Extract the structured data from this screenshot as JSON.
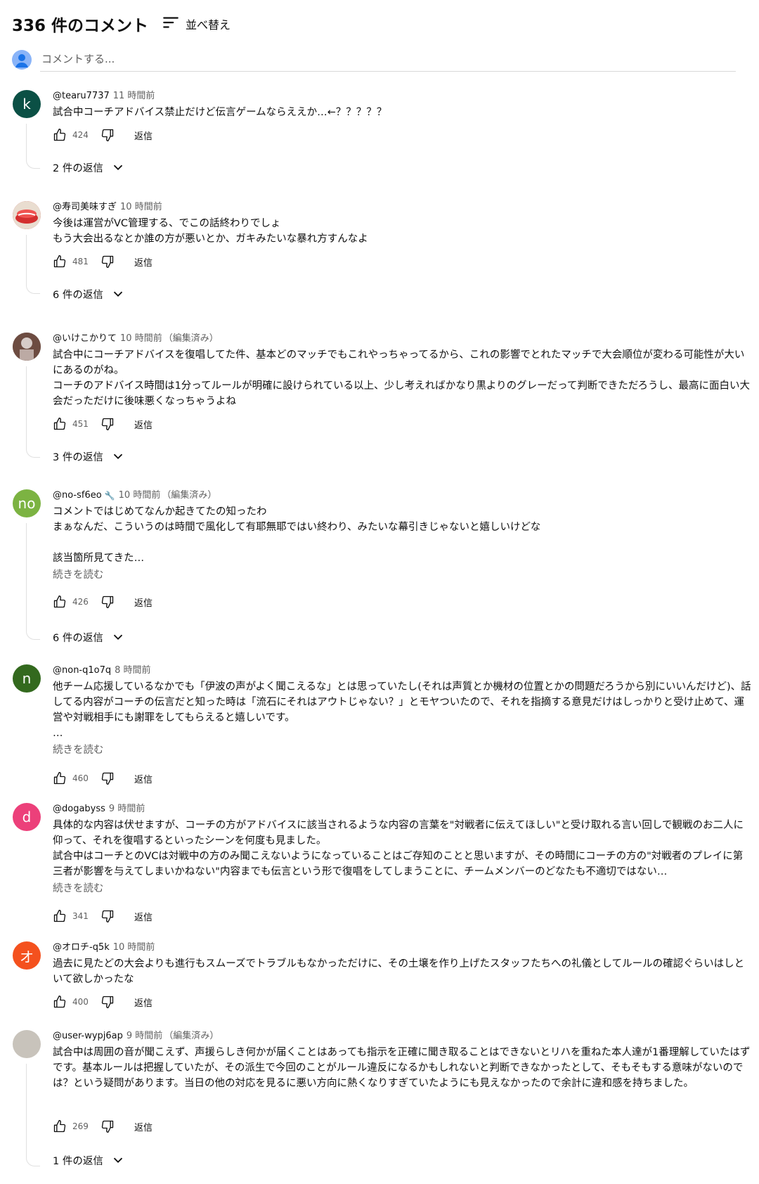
{
  "header": {
    "count_label": "336 件のコメント",
    "sort_label": "並べ替え"
  },
  "add_comment": {
    "placeholder": "コメントする..."
  },
  "actions_common": {
    "reply_label": "返信"
  },
  "comments": [
    {
      "author": "@tearu7737",
      "time": "11 時間前",
      "edited": "",
      "avatar": {
        "letter": "k",
        "color": "#0b5045"
      },
      "text": "試合中コーチアドバイス禁止だけど伝言ゲームならええか…←？？？？？",
      "likes": "424",
      "replies_label": "2 件の返信"
    },
    {
      "author": "@寿司美味すぎ",
      "time": "10 時間前",
      "edited": "",
      "avatar": {
        "letter": "",
        "color": "#c62828"
      },
      "text": "今後は運営がVC管理する、でこの話終わりでしょ\nもう大会出るなとか誰の方が悪いとか、ガキみたいな暴れ方すんなよ",
      "likes": "481",
      "replies_label": "6 件の返信"
    },
    {
      "author": "@いけこかりて",
      "time": "10 時間前",
      "edited": "（編集済み）",
      "avatar": {
        "letter": "",
        "color": "#8d6e63"
      },
      "text": "試合中にコーチアドバイスを復唱してた件、基本どのマッチでもこれやっちゃってるから、これの影響でとれたマッチで大会順位が変わる可能性が大いにあるのがね。\nコーチのアドバイス時間は1分ってルールが明確に設けられている以上、少し考えればかなり黒よりのグレーだって判断できただろうし、最高に面白い大会だっただけに後味悪くなっちゃうよね",
      "likes": "451",
      "replies_label": "3 件の返信"
    },
    {
      "author": "@no-sf6eo",
      "time": "10 時間前",
      "edited": "（編集済み）",
      "wrench": "🔧",
      "avatar": {
        "letter": "no",
        "color": "#7cb342"
      },
      "text": "コメントではじめてなんか起きてたの知ったわ\nまぁなんだ、こういうのは時間で風化して有耶無耶ではい終わり、みたいな幕引きじゃないと嬉しいけどな\n\n該当箇所見てきた…",
      "more": "続きを読む",
      "likes": "426",
      "replies_label": "6 件の返信"
    },
    {
      "author": "@non-q1o7q",
      "time": "8 時間前",
      "edited": "",
      "avatar": {
        "letter": "n",
        "color": "#33691e"
      },
      "text": "他チーム応援しているなかでも「伊波の声がよく聞こえるな」とは思っていたし(それは声質とか機材の位置とかの問題だろうから別にいいんだけど)、話してる内容がコーチの伝言だと知った時は「流石にそれはアウトじゃない？」とモヤついたので、それを指摘する意見だけはしっかりと受け止めて、運営や対戦相手にも謝罪をしてもらえると嬉しいです。\n…",
      "more": "続きを読む",
      "likes": "460",
      "replies_label": ""
    },
    {
      "author": "@dogabyss",
      "time": "9 時間前",
      "edited": "",
      "avatar": {
        "letter": "d",
        "color": "#ec407a"
      },
      "text": "具体的な内容は伏せますが、コーチの方がアドバイスに該当されるような内容の言葉を\"対戦者に伝えてほしい\"と受け取れる言い回しで観戦のお二人に仰って、それを復唱するといったシーンを何度も見ました。\n試合中はコーチとのVCは対戦中の方のみ聞こえないようになっていることはご存知のことと思いますが、その時間にコーチの方の\"対戦者のプレイに第三者が影響を与えてしまいかねない\"内容までも伝言という形で復唱をしてしまうことに、チームメンバーのどなたも不適切ではない…",
      "more": "続きを読む",
      "likes": "341",
      "replies_label": ""
    },
    {
      "author": "@オロチ-q5k",
      "time": "10 時間前",
      "edited": "",
      "avatar": {
        "letter": "オ",
        "color": "#f4511e"
      },
      "text": "過去に見たどの大会よりも進行もスムーズでトラブルもなかっただけに、その土壌を作り上げたスタッフたちへの礼儀としてルールの確認ぐらいはしといて欲しかったな",
      "likes": "400",
      "replies_label": ""
    },
    {
      "author": "@user-wypj6ap",
      "time": "9 時間前",
      "edited": "（編集済み）",
      "avatar": {
        "letter": "",
        "color": "#c8c3bb"
      },
      "text": "試合中は周囲の音が聞こえず、声援らしき何かが届くことはあっても指示を正確に聞き取ることはできないとリハを重ねた本人達が1番理解していたはずです。基本ルールは把握していたが、その派生で今回のことがルール違反になるかもしれないと判断できなかったとして、そもそもする意味がないのでは？という疑問があります。当日の他の対応を見るに悪い方向に熱くなりすぎていたようにも見えなかったので余計に違和感を持ちました。",
      "likes": "269",
      "replies_label": "1 件の返信"
    }
  ]
}
